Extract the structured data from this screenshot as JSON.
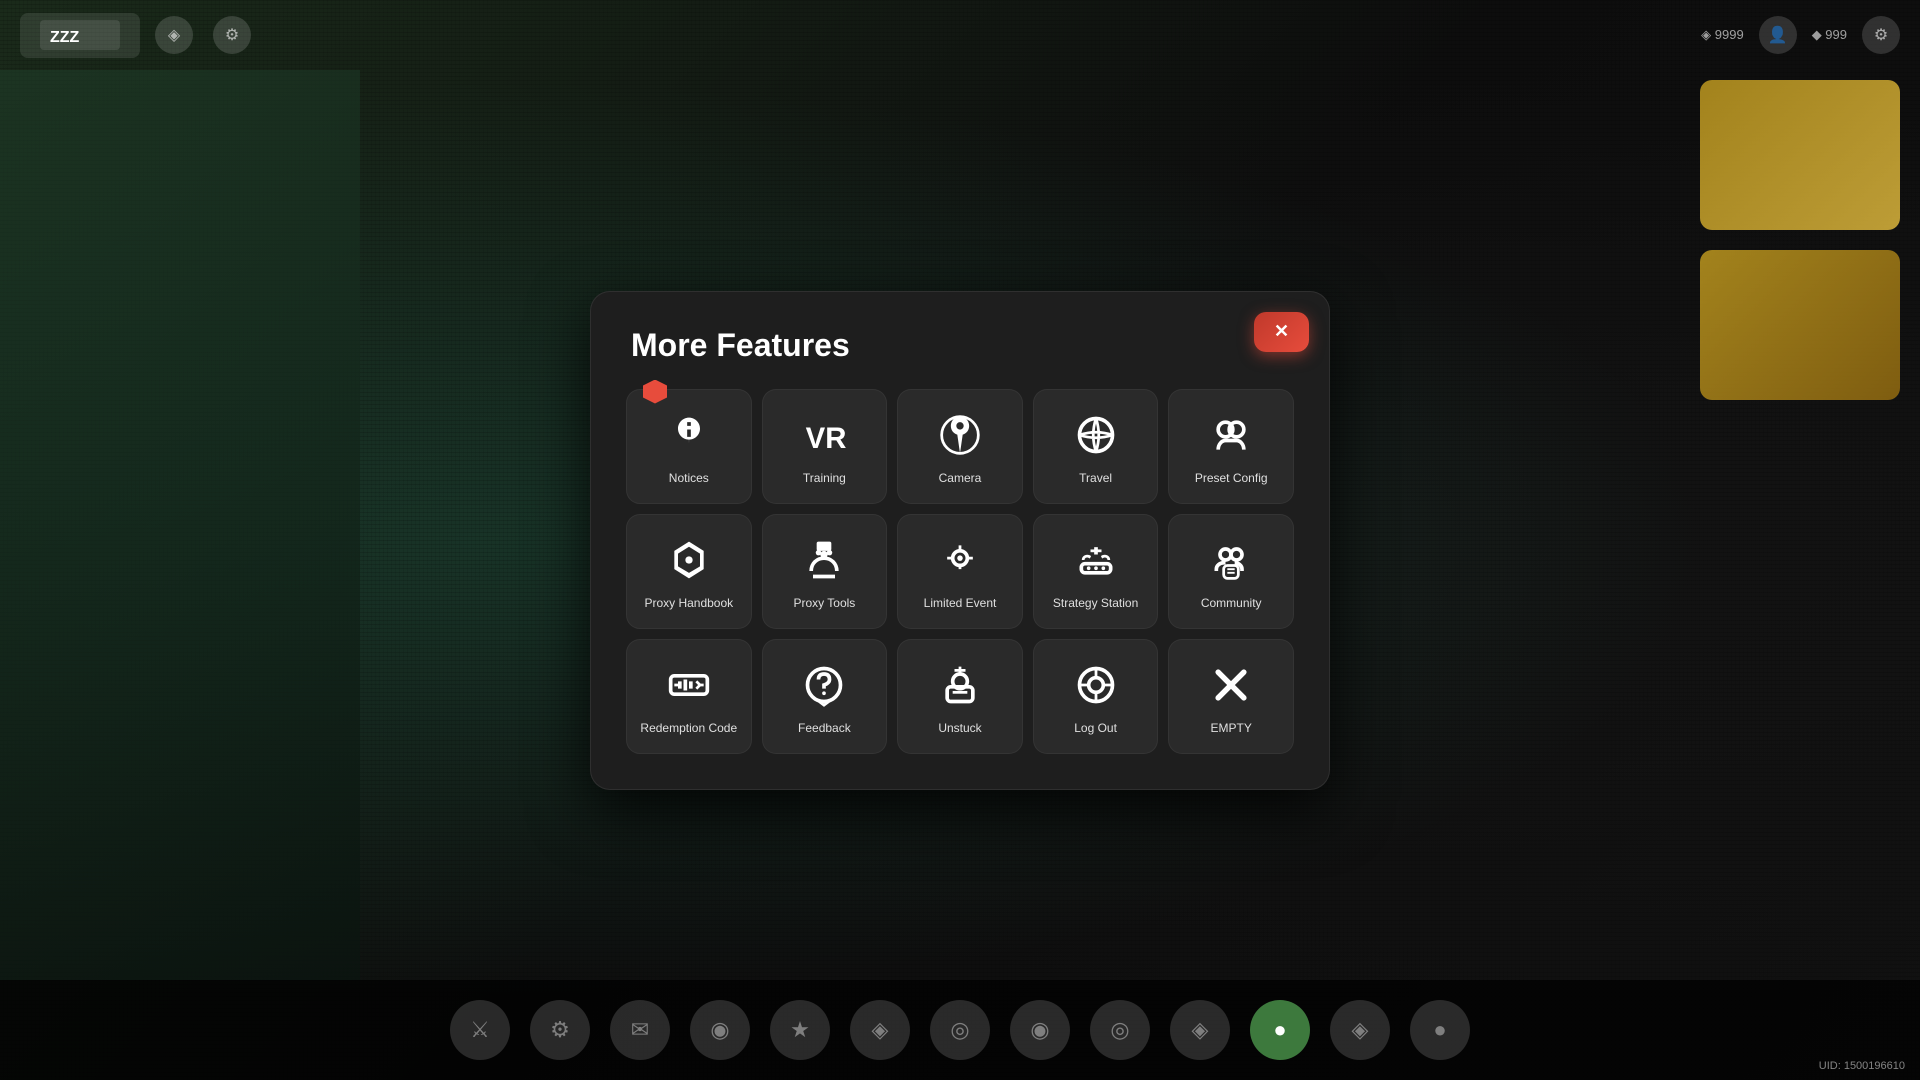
{
  "modal": {
    "title": "More Features",
    "close_label": "✕"
  },
  "grid": {
    "items": [
      {
        "id": "notices",
        "label": "Notices",
        "icon": "megaphone"
      },
      {
        "id": "training",
        "label": "Training",
        "icon": "vr"
      },
      {
        "id": "camera",
        "label": "Camera",
        "icon": "camera"
      },
      {
        "id": "travel",
        "label": "Travel",
        "icon": "travel"
      },
      {
        "id": "preset-config",
        "label": "Preset Config",
        "icon": "preset"
      },
      {
        "id": "proxy-handbook",
        "label": "Proxy\nHandbook",
        "icon": "handbook"
      },
      {
        "id": "proxy-tools",
        "label": "Proxy Tools",
        "icon": "tools"
      },
      {
        "id": "limited-event",
        "label": "Limited Event",
        "icon": "event"
      },
      {
        "id": "strategy-station",
        "label": "Strategy\nStation",
        "icon": "strategy"
      },
      {
        "id": "community",
        "label": "Community",
        "icon": "community"
      },
      {
        "id": "redemption-code",
        "label": "Redemption\nCode",
        "icon": "ticket"
      },
      {
        "id": "feedback",
        "label": "Feedback",
        "icon": "feedback"
      },
      {
        "id": "unstuck",
        "label": "Unstuck",
        "icon": "unstuck"
      },
      {
        "id": "log-out",
        "label": "Log Out",
        "icon": "logout"
      },
      {
        "id": "empty",
        "label": "EMPTY",
        "icon": "empty"
      }
    ]
  },
  "bottom_bar": {
    "icons": [
      "⚔",
      "⚙",
      "✉",
      "◉",
      "★",
      "◈",
      "◎",
      "◉",
      "◎",
      "◈",
      "◉",
      "◈",
      "●"
    ]
  },
  "uid": {
    "label": "UID: 1500196610"
  }
}
